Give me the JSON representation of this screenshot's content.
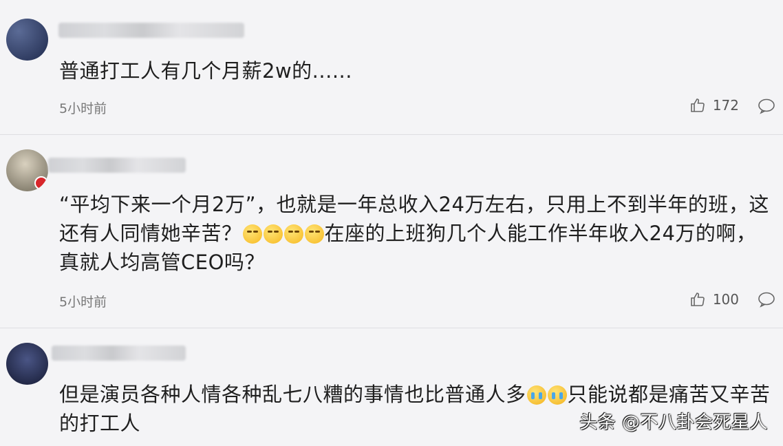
{
  "comments": [
    {
      "text": "普通打工人有几个月薪2w的......",
      "time": "5小时前",
      "likes": "172",
      "avatar_colors": [
        "#2b3a63",
        "#4e5f8a"
      ]
    },
    {
      "text_a": "“平均下来一个月2万”，也就是一年总收入24万左右，只用上不到半年的班，这还有人同情她辛苦？",
      "text_b": "在座的上班狗几个人能工作半年收入24万的啊，真就人均高管CEO吗？",
      "time": "5小时前",
      "likes": "100",
      "avatar_colors": [
        "#8a8470",
        "#cfc6b2"
      ]
    },
    {
      "text_a": "但是演员各种人情各种乱七八糟的事情也比普通人多",
      "text_b": "只能说都是痛苦又辛苦的打工人",
      "avatar_colors": [
        "#1e2340",
        "#3d4873"
      ]
    }
  ],
  "watermark": "头条 @不八卦会死星人",
  "icons": {
    "like": "thumbs-up-icon",
    "reply": "comment-bubble-icon",
    "emoji_grin": "grinning-face-icon",
    "emoji_cry": "crying-face-icon"
  }
}
